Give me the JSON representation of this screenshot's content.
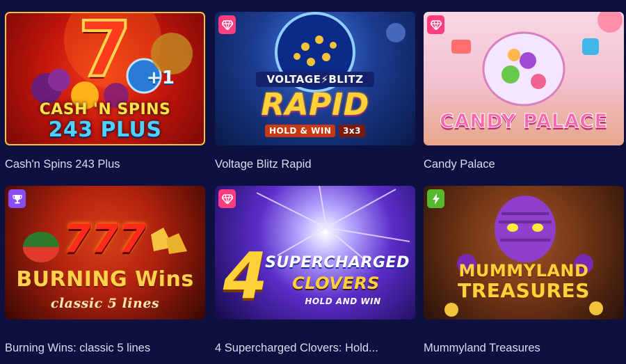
{
  "games": [
    {
      "title": "Cash'n Spins 243 Plus",
      "art_line1": "CASH 'N SPINS",
      "art_line2": "243 PLUS",
      "art_big": "7",
      "art_tag": "+1",
      "badge": null,
      "colors": {
        "bg1": "#c9180d",
        "bg2": "#7a0706",
        "border": "#f5c542"
      }
    },
    {
      "title": "Voltage Blitz Rapid",
      "art_line1": "VOLTAGE⚡BLITZ",
      "art_line2": "RAPID",
      "art_tag": "HOLD & WIN",
      "art_tag2": "3x3",
      "badge": "diamond-icon",
      "colors": {
        "bg1": "#1c3c8f",
        "bg2": "#0a1a4a"
      }
    },
    {
      "title": "Candy Palace",
      "art_line1": "CANDY PALACE",
      "badge": "diamond-icon",
      "colors": {
        "bg1": "#f6c9d8",
        "bg2": "#e6a07f"
      }
    },
    {
      "title": "Burning Wins: classic 5 lines",
      "art_big": "777",
      "art_line1": "BURNING Wins",
      "art_line2": "classic 5 lines",
      "badge": "trophy-icon",
      "colors": {
        "bg1": "#b3230e",
        "bg2": "#3a0703"
      }
    },
    {
      "title": "4 Supercharged Clovers: Hold...",
      "art_big": "4",
      "art_line1": "SUPERCHARGED",
      "art_line2": "CLOVERS",
      "art_tag": "HOLD AND WIN",
      "badge": "diamond-icon",
      "colors": {
        "bg1": "#5b2cc9",
        "bg2": "#150a4a"
      }
    },
    {
      "title": "Mummyland Treasures",
      "art_line1": "MUMMYLAND",
      "art_line2": "TREASURES",
      "badge": "lightning-icon",
      "colors": {
        "bg1": "#7a3a17",
        "bg2": "#2a120a"
      }
    }
  ],
  "badge_colors": {
    "diamond-icon": "#ff3d7f",
    "trophy-icon": "#8a4df2",
    "lightning-icon": "#55b82e"
  }
}
